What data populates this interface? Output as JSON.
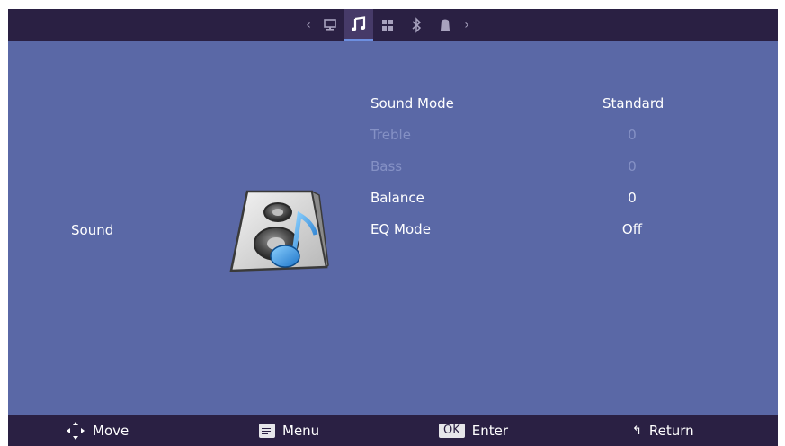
{
  "top_bar": {
    "tabs": [
      {
        "icon": "monitor-icon",
        "active": false
      },
      {
        "icon": "music-note-icon",
        "active": true
      },
      {
        "icon": "grid-icon",
        "active": false
      },
      {
        "icon": "bluetooth-icon",
        "active": false
      },
      {
        "icon": "lock-icon",
        "active": false
      }
    ],
    "prev_arrow": "‹",
    "next_arrow": "›"
  },
  "page": {
    "category_label": "Sound",
    "graphic": "speaker-music-icon"
  },
  "settings": [
    {
      "label": "Sound Mode",
      "value": "Standard",
      "enabled": true
    },
    {
      "label": "Treble",
      "value": "0",
      "enabled": false
    },
    {
      "label": "Bass",
      "value": "0",
      "enabled": false
    },
    {
      "label": "Balance",
      "value": "0",
      "enabled": true
    },
    {
      "label": "EQ Mode",
      "value": "Off",
      "enabled": true
    }
  ],
  "bottom_bar": {
    "move": "Move",
    "menu": "Menu",
    "ok_key": "OK",
    "enter": "Enter",
    "return_glyph": "↰",
    "return": "Return"
  },
  "colors": {
    "background": "#5a68a6",
    "bars": "#2a2043",
    "disabled_text": "#8591c5"
  }
}
